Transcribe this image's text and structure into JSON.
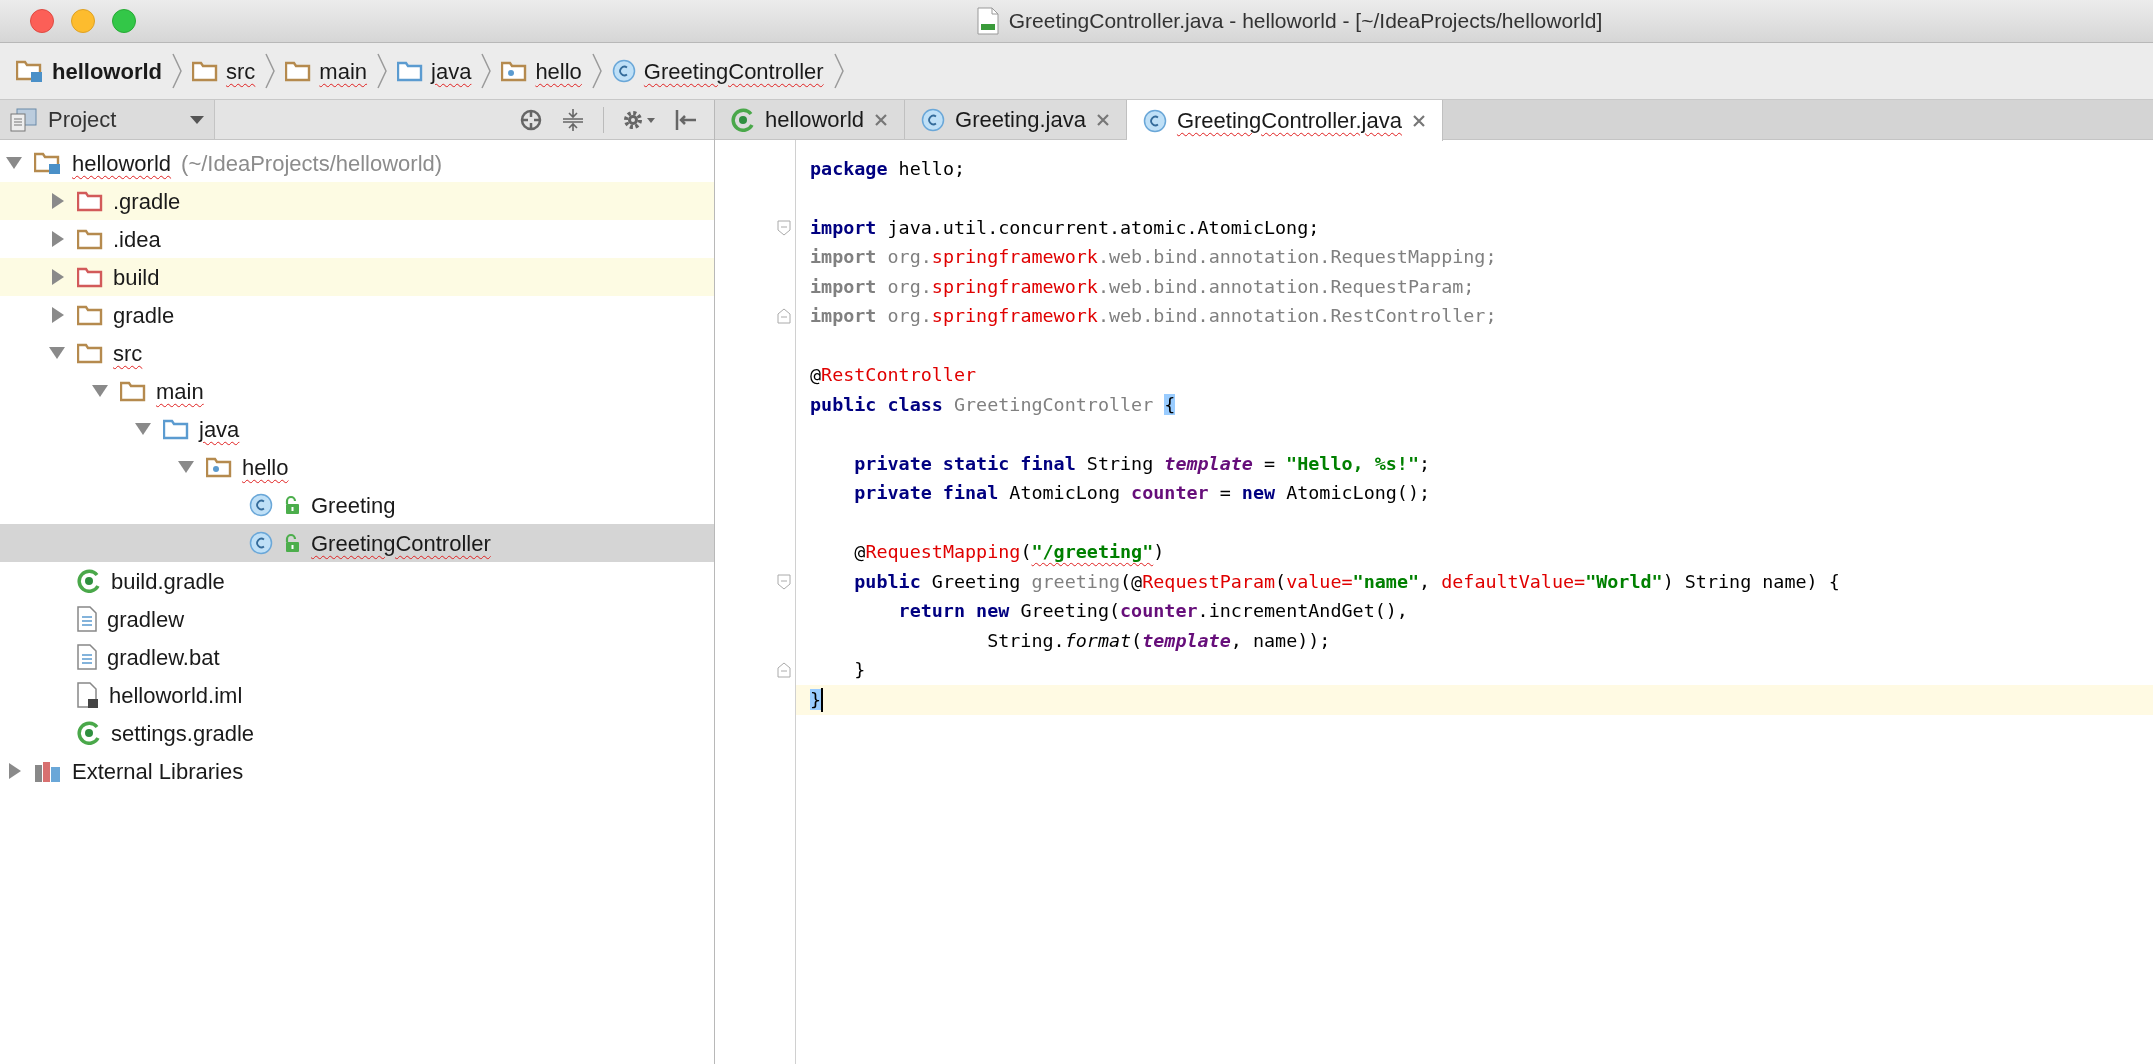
{
  "window": {
    "title": "GreetingController.java - helloworld - [~/IdeaProjects/helloworld]"
  },
  "breadcrumbs": [
    {
      "label": "helloworld",
      "kind": "project",
      "typo": false,
      "bold": true
    },
    {
      "label": "src",
      "kind": "folder",
      "typo": true,
      "bold": false
    },
    {
      "label": "main",
      "kind": "folder",
      "typo": true,
      "bold": false
    },
    {
      "label": "java",
      "kind": "source",
      "typo": true,
      "bold": false
    },
    {
      "label": "hello",
      "kind": "package",
      "typo": true,
      "bold": false
    },
    {
      "label": "GreetingController",
      "kind": "class",
      "typo": true,
      "bold": false
    }
  ],
  "project_panel": {
    "title": "Project",
    "tree": [
      {
        "label": "helloworld",
        "hint": "(~/IdeaProjects/helloworld)",
        "kind": "project",
        "expanded": true,
        "selected": false,
        "ignored": false,
        "typo": true,
        "children": [
          {
            "label": ".gradle",
            "kind": "excluded",
            "expanded": false,
            "selected": false,
            "ignored": true,
            "typo": false
          },
          {
            "label": ".idea",
            "kind": "folder",
            "expanded": false,
            "selected": false,
            "ignored": false,
            "typo": false
          },
          {
            "label": "build",
            "kind": "excluded",
            "expanded": false,
            "selected": false,
            "ignored": true,
            "typo": false
          },
          {
            "label": "gradle",
            "kind": "folder",
            "expanded": false,
            "selected": false,
            "ignored": false,
            "typo": false
          },
          {
            "label": "src",
            "kind": "folder",
            "expanded": true,
            "selected": false,
            "ignored": false,
            "typo": true,
            "children": [
              {
                "label": "main",
                "kind": "folder",
                "expanded": true,
                "selected": false,
                "ignored": false,
                "typo": true,
                "children": [
                  {
                    "label": "java",
                    "kind": "source",
                    "expanded": true,
                    "selected": false,
                    "ignored": false,
                    "typo": true,
                    "children": [
                      {
                        "label": "hello",
                        "kind": "package",
                        "expanded": true,
                        "selected": false,
                        "ignored": false,
                        "typo": true,
                        "children": [
                          {
                            "label": "Greeting",
                            "kind": "class",
                            "selected": false,
                            "ignored": false,
                            "typo": false
                          },
                          {
                            "label": "GreetingController",
                            "kind": "class",
                            "selected": true,
                            "ignored": false,
                            "typo": true
                          }
                        ]
                      }
                    ]
                  }
                ]
              }
            ]
          },
          {
            "label": "build.gradle",
            "kind": "gradle",
            "selected": false,
            "ignored": false,
            "typo": false
          },
          {
            "label": "gradlew",
            "kind": "file",
            "selected": false,
            "ignored": false,
            "typo": false
          },
          {
            "label": "gradlew.bat",
            "kind": "file",
            "selected": false,
            "ignored": false,
            "typo": false
          },
          {
            "label": "helloworld.iml",
            "kind": "iml",
            "selected": false,
            "ignored": false,
            "typo": false
          },
          {
            "label": "settings.gradle",
            "kind": "gradle",
            "selected": false,
            "ignored": false,
            "typo": false
          }
        ]
      },
      {
        "label": "External Libraries",
        "kind": "libraries",
        "expanded": false,
        "selected": false,
        "ignored": false,
        "typo": false
      }
    ]
  },
  "tabs": [
    {
      "label": "helloworld",
      "kind": "gradle",
      "selected": false,
      "typo": false
    },
    {
      "label": "Greeting.java",
      "kind": "class",
      "selected": false,
      "typo": false
    },
    {
      "label": "GreetingController.java",
      "kind": "class",
      "selected": true,
      "typo": true
    }
  ],
  "editor": {
    "lines": [
      {
        "kind": "code",
        "tokens": [
          {
            "text": "package",
            "kind": "kw"
          },
          {
            "text": " hello;",
            "kind": "plain"
          }
        ]
      },
      {
        "kind": "blank"
      },
      {
        "kind": "fold-start",
        "tokens": [
          {
            "text": "import",
            "kind": "kw"
          },
          {
            "text": " java.util.concurrent.atomic.AtomicLong;",
            "kind": "plain"
          }
        ]
      },
      {
        "kind": "code",
        "tokens": [
          {
            "text": "import",
            "kind": "unused-kw"
          },
          {
            "text": " org.",
            "kind": "unused"
          },
          {
            "text": "springframework",
            "kind": "error"
          },
          {
            "text": ".web.bind.annotation.RequestMapping;",
            "kind": "unused"
          }
        ]
      },
      {
        "kind": "code",
        "tokens": [
          {
            "text": "import",
            "kind": "unused-kw"
          },
          {
            "text": " org.",
            "kind": "unused"
          },
          {
            "text": "springframework",
            "kind": "error"
          },
          {
            "text": ".web.bind.annotation.RequestParam;",
            "kind": "unused"
          }
        ]
      },
      {
        "kind": "fold-end",
        "tokens": [
          {
            "text": "import",
            "kind": "unused-kw"
          },
          {
            "text": " org.",
            "kind": "unused"
          },
          {
            "text": "springframework",
            "kind": "error"
          },
          {
            "text": ".web.bind.annotation.RestController;",
            "kind": "unused"
          }
        ]
      },
      {
        "kind": "blank"
      },
      {
        "kind": "code",
        "tokens": [
          {
            "text": "@",
            "kind": "plain"
          },
          {
            "text": "RestController",
            "kind": "error"
          }
        ]
      },
      {
        "kind": "code",
        "tokens": [
          {
            "text": "public class",
            "kind": "kw"
          },
          {
            "text": " GreetingController ",
            "kind": "unused"
          },
          {
            "text": "{",
            "kind": "match"
          }
        ]
      },
      {
        "kind": "blank"
      },
      {
        "kind": "code",
        "tokens": [
          {
            "text": "    private static final",
            "kind": "kw"
          },
          {
            "text": " String ",
            "kind": "plain"
          },
          {
            "text": "template",
            "kind": "static"
          },
          {
            "text": " = ",
            "kind": "plain"
          },
          {
            "text": "\"Hello, %s!\"",
            "kind": "string"
          },
          {
            "text": ";",
            "kind": "plain"
          }
        ]
      },
      {
        "kind": "code",
        "tokens": [
          {
            "text": "    private final",
            "kind": "kw"
          },
          {
            "text": " AtomicLong ",
            "kind": "plain"
          },
          {
            "text": "counter",
            "kind": "field"
          },
          {
            "text": " = ",
            "kind": "plain"
          },
          {
            "text": "new",
            "kind": "kw"
          },
          {
            "text": " AtomicLong();",
            "kind": "plain"
          }
        ]
      },
      {
        "kind": "blank"
      },
      {
        "kind": "code",
        "tokens": [
          {
            "text": "    @",
            "kind": "plain"
          },
          {
            "text": "RequestMapping",
            "kind": "error"
          },
          {
            "text": "(",
            "kind": "plain"
          },
          {
            "text": "\"/greeting\"",
            "kind": "string-typo"
          },
          {
            "text": ")",
            "kind": "plain"
          }
        ]
      },
      {
        "kind": "fold-start",
        "tokens": [
          {
            "text": "    public",
            "kind": "kw"
          },
          {
            "text": " Greeting ",
            "kind": "plain"
          },
          {
            "text": "greeting",
            "kind": "unused"
          },
          {
            "text": "(@",
            "kind": "plain"
          },
          {
            "text": "RequestParam",
            "kind": "error"
          },
          {
            "text": "(",
            "kind": "plain"
          },
          {
            "text": "value=",
            "kind": "error"
          },
          {
            "text": "\"name\"",
            "kind": "string"
          },
          {
            "text": ", ",
            "kind": "plain"
          },
          {
            "text": "defaultValue=",
            "kind": "error"
          },
          {
            "text": "\"World\"",
            "kind": "string"
          },
          {
            "text": ") String name) {",
            "kind": "plain"
          }
        ]
      },
      {
        "kind": "code",
        "tokens": [
          {
            "text": "        return new",
            "kind": "kw"
          },
          {
            "text": " Greeting(",
            "kind": "plain"
          },
          {
            "text": "counter",
            "kind": "field"
          },
          {
            "text": ".incrementAndGet(),",
            "kind": "plain"
          }
        ]
      },
      {
        "kind": "code",
        "tokens": [
          {
            "text": "                String.",
            "kind": "plain"
          },
          {
            "text": "format",
            "kind": "italic"
          },
          {
            "text": "(",
            "kind": "plain"
          },
          {
            "text": "template",
            "kind": "static"
          },
          {
            "text": ", name));",
            "kind": "plain"
          }
        ]
      },
      {
        "kind": "fold-end",
        "tokens": [
          {
            "text": "    }",
            "kind": "plain"
          }
        ]
      },
      {
        "kind": "caret",
        "tokens": [
          {
            "text": "}",
            "kind": "match"
          }
        ]
      }
    ]
  }
}
